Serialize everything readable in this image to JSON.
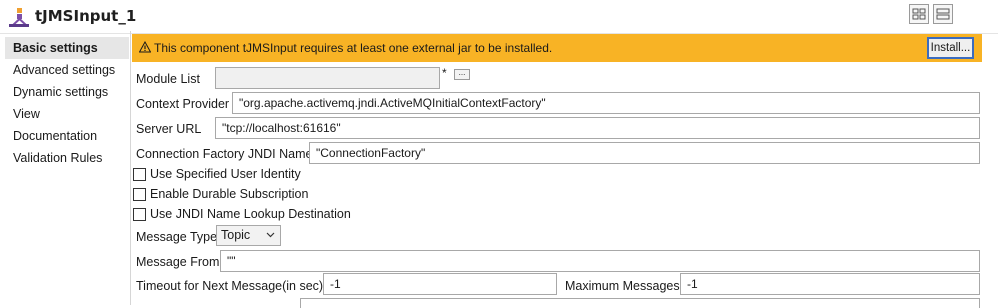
{
  "component": {
    "title": "tJMSInput_1"
  },
  "sidebar": {
    "items": [
      {
        "label": "Basic settings"
      },
      {
        "label": "Advanced settings"
      },
      {
        "label": "Dynamic settings"
      },
      {
        "label": "View"
      },
      {
        "label": "Documentation"
      },
      {
        "label": "Validation Rules"
      }
    ]
  },
  "banner": {
    "message": "This component tJMSInput requires at least one external jar to be installed.",
    "install_label": "Install...",
    "color": "#f8b325"
  },
  "form": {
    "module_list": {
      "label": "Module List",
      "value": "",
      "required_mark": "*",
      "browse_label": "..."
    },
    "context_provider": {
      "label": "Context Provider",
      "value": "\"org.apache.activemq.jndi.ActiveMQInitialContextFactory\""
    },
    "server_url": {
      "label": "Server URL",
      "value": "\"tcp://localhost:61616\""
    },
    "connection_factory": {
      "label": "Connection Factory JNDI Name",
      "value": "\"ConnectionFactory\""
    },
    "use_specified_user_identity": {
      "label": "Use Specified User Identity",
      "checked": false
    },
    "enable_durable_subscription": {
      "label": "Enable Durable Subscription",
      "checked": false
    },
    "use_jndi_lookup": {
      "label": "Use JNDI Name Lookup Destination",
      "checked": false
    },
    "message_type": {
      "label": "Message Type",
      "value": "Topic"
    },
    "message_from": {
      "label": "Message From",
      "value": "\"\""
    },
    "timeout": {
      "label": "Timeout for Next Message(in sec)",
      "value": "-1"
    },
    "max_messages": {
      "label": "Maximum Messages",
      "value": "-1"
    }
  }
}
